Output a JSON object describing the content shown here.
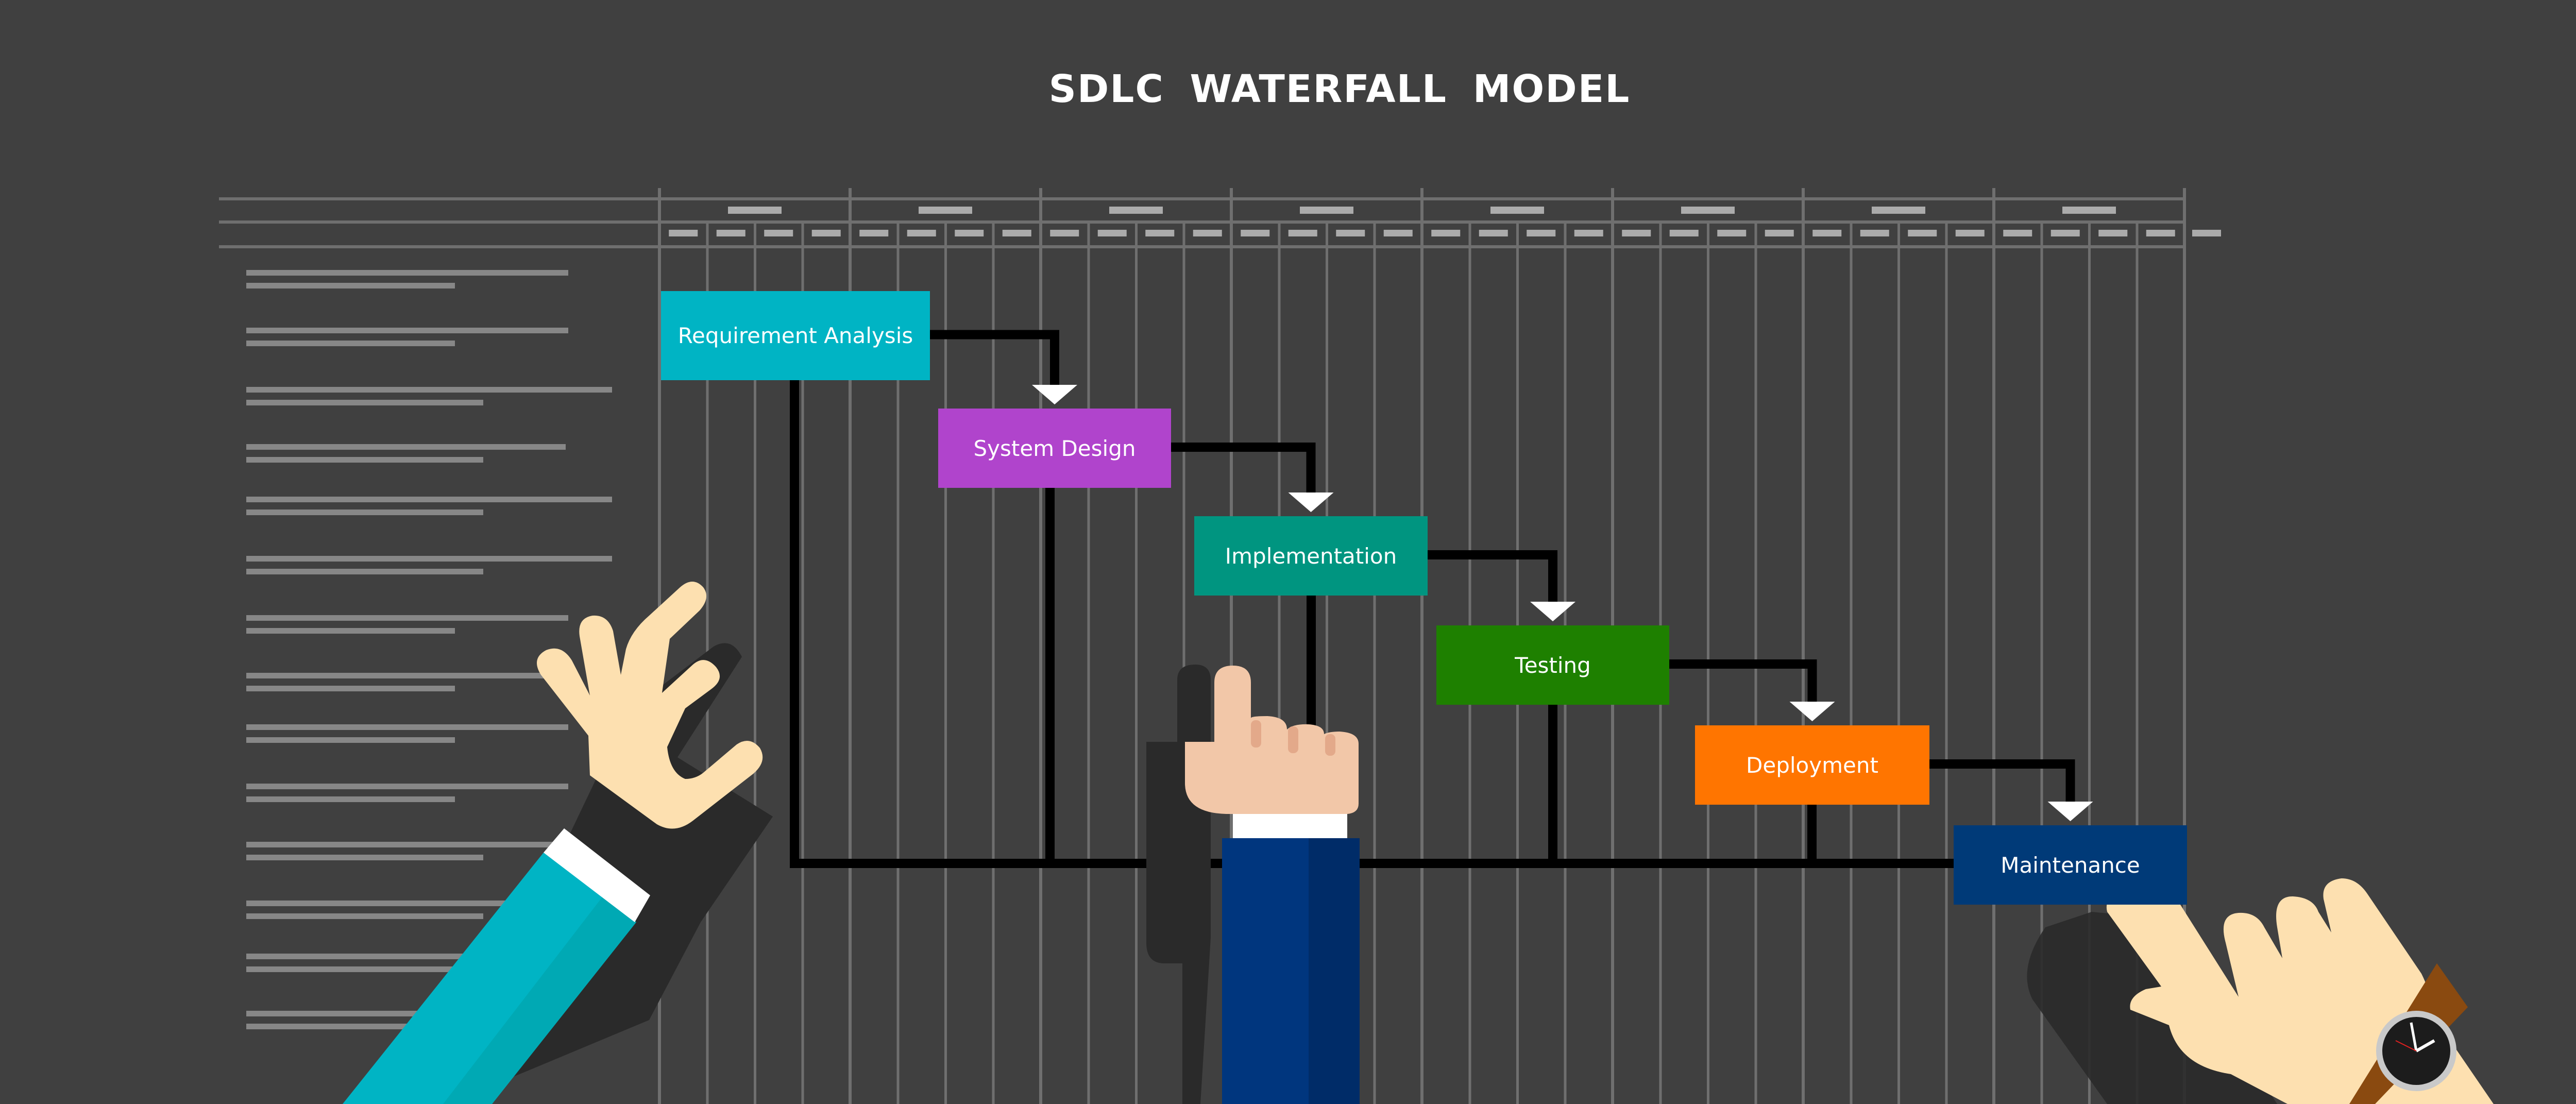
{
  "title": "SDLC  WATERFALL  MODEL",
  "colors": {
    "background": "#404040",
    "grid_line": "#6f6f6f",
    "header_bar": "#ababab",
    "row_bar": "#878787",
    "connector": "#ffffff",
    "skin_light": "#fde0b0",
    "skin_peach": "#f2c7a8",
    "skin_shade": "#e3a98a",
    "sleeve_teal": "#00b4c4",
    "sleeve_navy": "#00367e",
    "watch_strap": "#8a4a10",
    "shadow": "#2a2a2a"
  },
  "phases": [
    {
      "label": "Requirement Analysis",
      "color": "#00b4c4"
    },
    {
      "label": "System Design",
      "color": "#b044cc"
    },
    {
      "label": "Implementation",
      "color": "#009580"
    },
    {
      "label": "Testing",
      "color": "#1e8000"
    },
    {
      "label": "Deployment",
      "color": "#ff7500"
    },
    {
      "label": "Maintenance",
      "color": "#003a78"
    }
  ],
  "timeline": {
    "major_columns": 8,
    "minor_per_major": 4
  },
  "task_rows": 14
}
